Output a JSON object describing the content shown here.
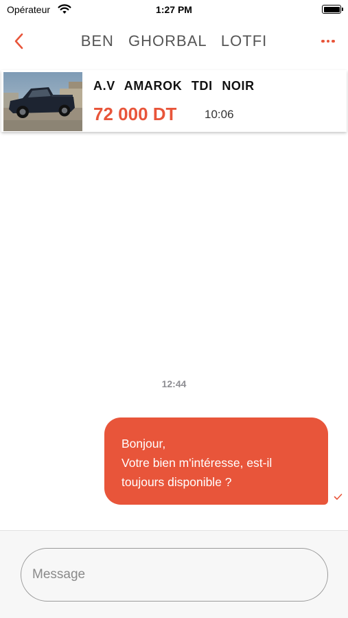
{
  "status_bar": {
    "carrier": "Opérateur",
    "time": "1:27 PM",
    "wifi_icon": "wifi-icon",
    "battery_icon": "battery-icon",
    "battery_level": 1.0
  },
  "nav": {
    "back_icon": "chevron-left-icon",
    "title": "BEN  GHORBAL   LOTFI",
    "more_icon": "ellipsis-icon"
  },
  "listing": {
    "photo": "car-photo",
    "title": "A.V   AMAROK  TDI  NOIR",
    "price": "72 000 DT",
    "time": "10:06"
  },
  "conversation": {
    "day_time": "12:44",
    "messages": [
      {
        "direction": "outgoing",
        "lines": [
          "Bonjour,",
          "Votre bien m'intéresse, est-il",
          "toujours disponible ?"
        ],
        "status_icon": "checkmark-icon"
      }
    ]
  },
  "composer": {
    "placeholder": "Message",
    "value": ""
  },
  "colors": {
    "accent": "#e8553a",
    "timestamp": "#8e8e93",
    "composer_bg": "#f7f7f7"
  }
}
